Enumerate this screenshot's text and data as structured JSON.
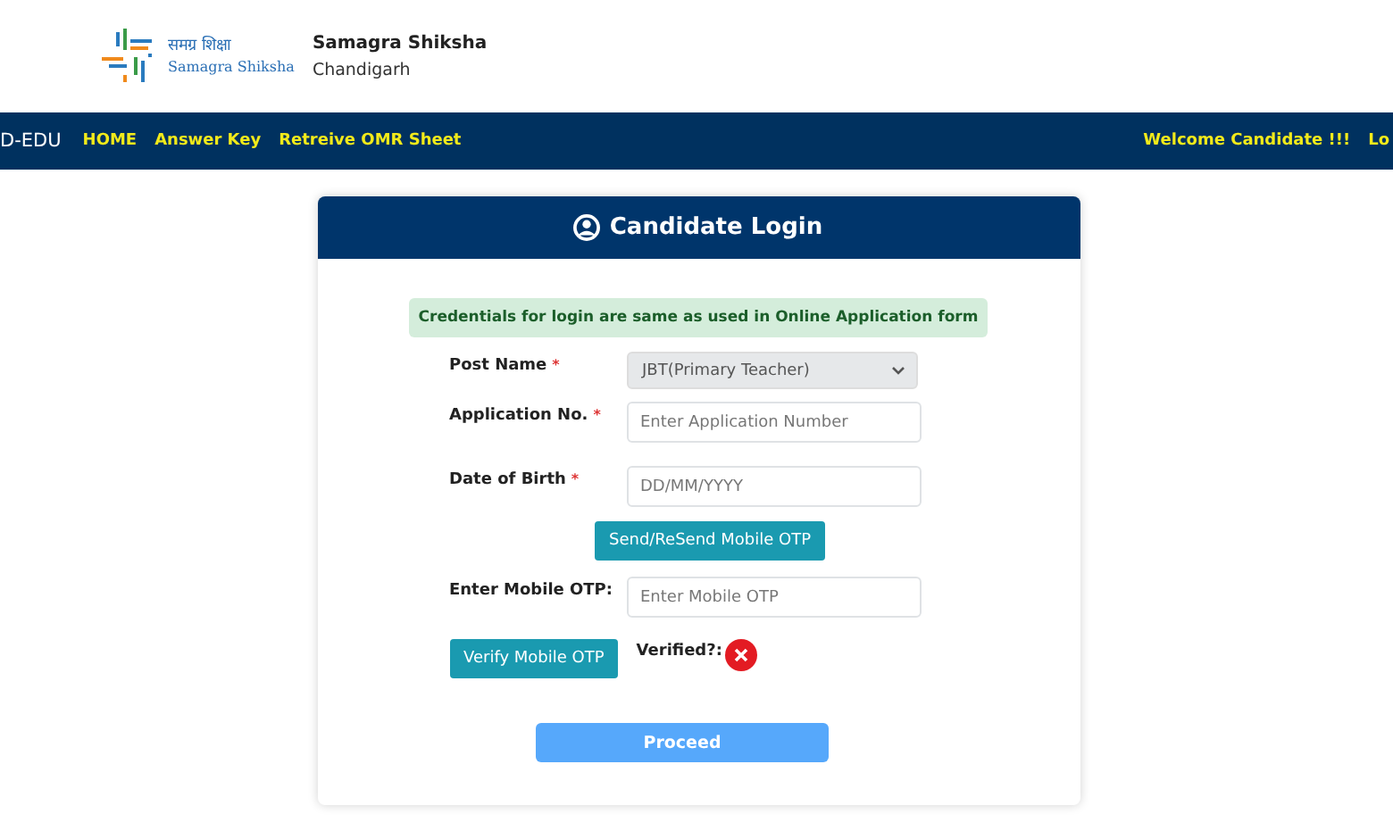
{
  "brand": {
    "logo_hindi": "समग्र शिक्षा",
    "logo_english": "Samagra Shiksha",
    "title": "Samagra Shiksha",
    "subtitle": "Chandigarh"
  },
  "navbar": {
    "brand": "D-EDU",
    "links": [
      "HOME",
      "Answer Key",
      "Retreive OMR Sheet"
    ],
    "welcome": "Welcome Candidate !!!",
    "right_cut": "Lo"
  },
  "card": {
    "title": "Candidate Login",
    "notice": "Credentials for login are same as used in Online Application form",
    "fields": [
      {
        "kind": "select",
        "label": "Post Name",
        "required_mark": "*",
        "value": "JBT(Primary Teacher)",
        "disabled": true
      },
      {
        "kind": "input",
        "label": "Application No.",
        "required_mark": "*",
        "placeholder": "Enter Application Number"
      },
      {
        "kind": "input",
        "label": "Date of Birth",
        "required_mark": "*",
        "placeholder": "DD/MM/YYYY"
      },
      {
        "kind": "button",
        "label": "Send/ReSend Mobile OTP"
      },
      {
        "kind": "input",
        "label": "Enter Mobile OTP:",
        "placeholder": "Enter Mobile OTP"
      }
    ],
    "verify_button": "Verify Mobile OTP",
    "verified_label": "Verified?:",
    "verified": false,
    "proceed": "Proceed"
  }
}
